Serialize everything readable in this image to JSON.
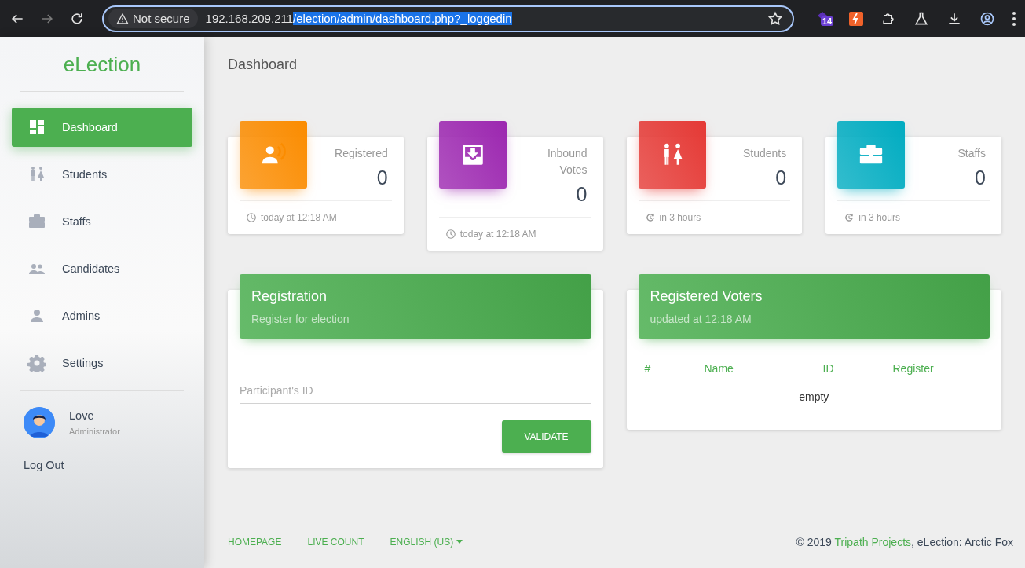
{
  "browser": {
    "security_label": "Not secure",
    "url_host": "192.168.209.211",
    "url_path": "/election/admin/dashboard.php?_loggedin",
    "url_path_selected": true,
    "extension_badge": "14"
  },
  "sidebar": {
    "logo": "eLection",
    "items": [
      {
        "label": "Dashboard",
        "selected": true
      },
      {
        "label": "Students",
        "selected": false
      },
      {
        "label": "Staffs",
        "selected": false
      },
      {
        "label": "Candidates",
        "selected": false
      },
      {
        "label": "Admins",
        "selected": false
      },
      {
        "label": "Settings",
        "selected": false
      }
    ],
    "user": {
      "name": "Love",
      "role": "Administrator"
    },
    "logout": "Log Out"
  },
  "page_title": "Dashboard",
  "stats": [
    {
      "label": "Registered",
      "value": "0",
      "footer": "today at 12:18 AM",
      "color": "#fb8c00"
    },
    {
      "label": "Inbound Votes",
      "value": "0",
      "footer": "today at 12:18 AM",
      "color": "#9c27b0"
    },
    {
      "label": "Students",
      "value": "0",
      "footer": "in 3 hours",
      "color": "#e53935"
    },
    {
      "label": "Staffs",
      "value": "0",
      "footer": "in 3 hours",
      "color": "#00acc1"
    }
  ],
  "registration": {
    "title": "Registration",
    "subtitle": "Register for election",
    "field_placeholder": "Participant's ID",
    "button": "VALIDATE"
  },
  "voters": {
    "title": "Registered Voters",
    "subtitle": "updated at 12:18 AM",
    "columns": [
      "#",
      "Name",
      "ID",
      "Register"
    ],
    "empty": "empty"
  },
  "footer": {
    "links": [
      {
        "label": "HOMEPAGE",
        "kind": "link"
      },
      {
        "label": "LIVE COUNT",
        "kind": "link"
      },
      {
        "label": "ENGLISH (US)",
        "kind": "dropdown"
      }
    ],
    "copyright_before": "© 2019 ",
    "copyright_link": "Tripath Projects",
    "copyright_after": ", eLection: Arctic Fox"
  }
}
